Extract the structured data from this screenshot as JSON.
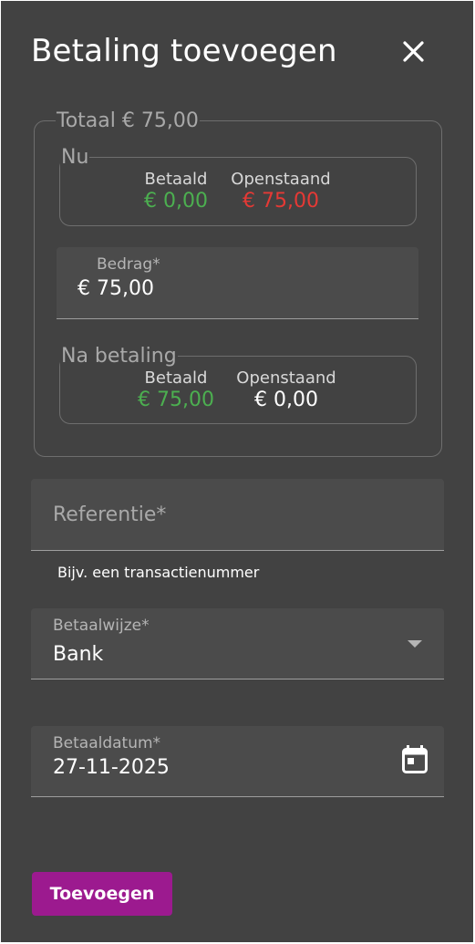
{
  "dialog": {
    "title": "Betaling toevoegen",
    "close_icon": "close-icon"
  },
  "total": {
    "legend": "Totaal € 75,00"
  },
  "now": {
    "legend": "Nu",
    "paid_label": "Betaald",
    "paid_value": "€ 0,00",
    "open_label": "Openstaand",
    "open_value": "€ 75,00"
  },
  "amount": {
    "label": "Bedrag*",
    "value": "€ 75,00"
  },
  "after": {
    "legend": "Na betaling",
    "paid_label": "Betaald",
    "paid_value": "€ 75,00",
    "open_label": "Openstaand",
    "open_value": "€ 0,00"
  },
  "reference": {
    "placeholder": "Referentie*",
    "hint": "Bijv. een transactienummer"
  },
  "payment_method": {
    "label": "Betaalwijze*",
    "value": "Bank",
    "icon": "chevron-down-icon"
  },
  "payment_date": {
    "label": "Betaaldatum*",
    "value": "27-11-2025",
    "icon": "calendar-icon"
  },
  "actions": {
    "submit_label": "Toevoegen"
  },
  "colors": {
    "background": "#424242",
    "positive": "#4caf50",
    "negative": "#e53935",
    "accent": "#9c1a8f"
  }
}
